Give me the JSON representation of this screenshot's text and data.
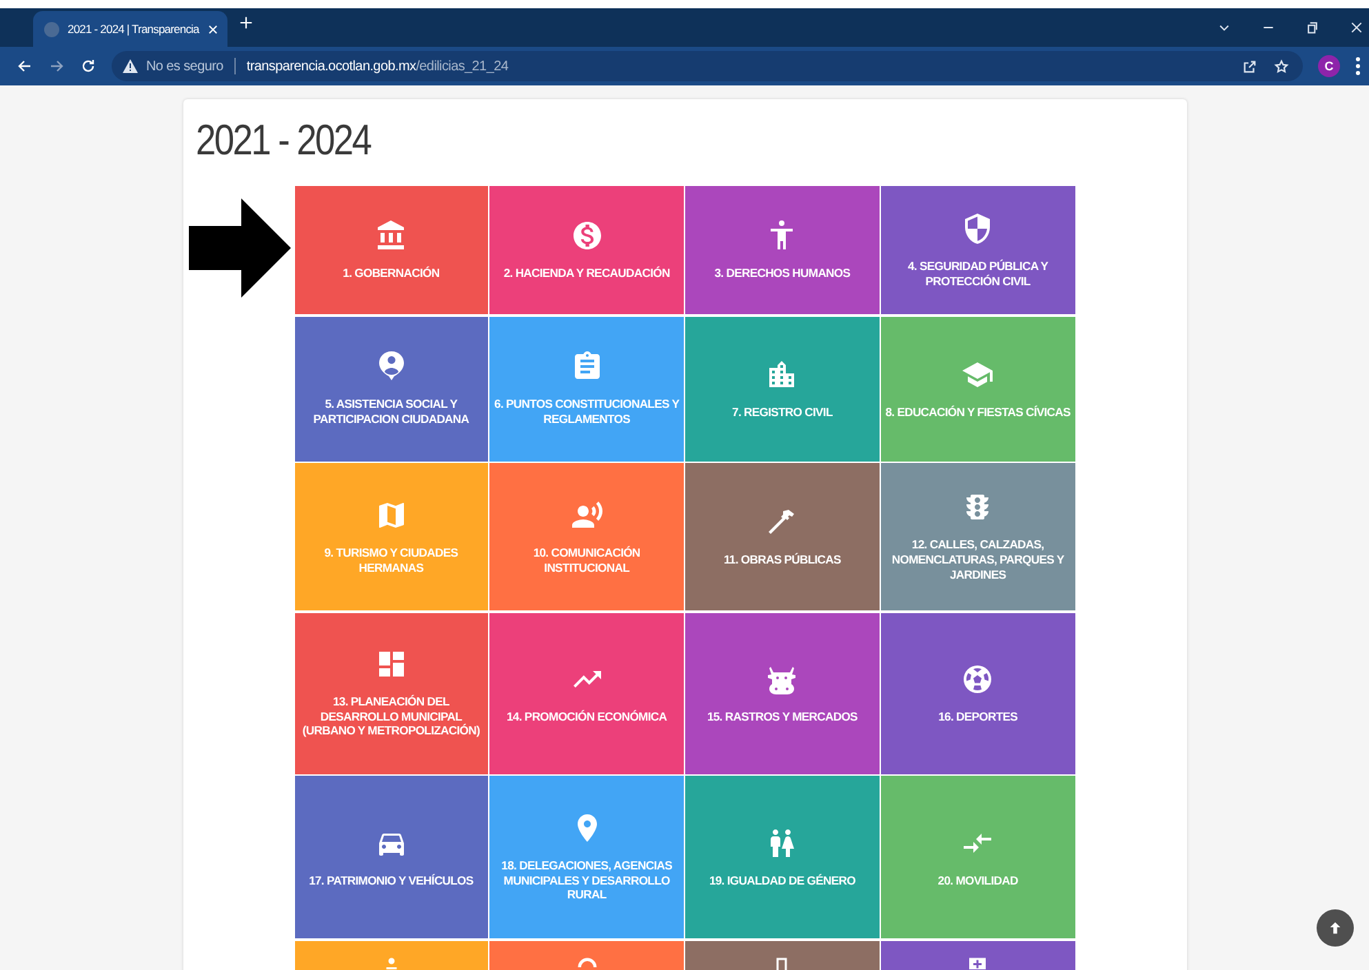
{
  "browser": {
    "tab_title": "2021 - 2024 | Transparencia",
    "security_label": "No es seguro",
    "url_host": "transparencia.ocotlan.gob.mx",
    "url_path": "/edilicias_21_24",
    "profile_initial": "C"
  },
  "page": {
    "title": "2021 - 2024",
    "tiles": [
      {
        "label": "1. GOBERNACIÓN",
        "color": "#ef5350"
      },
      {
        "label": "2. HACIENDA Y RECAUDACIÓN",
        "color": "#ec407a"
      },
      {
        "label": "3. DERECHOS HUMANOS",
        "color": "#ab47bc"
      },
      {
        "label": "4. SEGURIDAD PÚBLICA Y PROTECCIÓN CIVIL",
        "color": "#7e57c2"
      },
      {
        "label": "5. ASISTENCIA SOCIAL Y PARTICIPACION CIUDADANA",
        "color": "#5c6bc0"
      },
      {
        "label": "6. PUNTOS CONSTITUCIONALES Y REGLAMENTOS",
        "color": "#42a5f5"
      },
      {
        "label": "7. REGISTRO CIVIL",
        "color": "#26a69a"
      },
      {
        "label": "8. EDUCACIÓN Y FIESTAS CÍVICAS",
        "color": "#66bb6a"
      },
      {
        "label": "9. TURISMO Y CIUDADES HERMANAS",
        "color": "#ffa726"
      },
      {
        "label": "10. COMUNICACIÓN INSTITUCIONAL",
        "color": "#ff7043"
      },
      {
        "label": "11. OBRAS PÚBLICAS",
        "color": "#8d6e63"
      },
      {
        "label": "12. CALLES, CALZADAS, NOMENCLATURAS, PARQUES Y JARDINES",
        "color": "#78909c"
      },
      {
        "label": "13. PLANEACIÓN DEL DESARROLLO MUNICIPAL (URBANO Y METROPOLIZACIÓN)",
        "color": "#ef5350"
      },
      {
        "label": "14. PROMOCIÓN ECONÓMICA",
        "color": "#ec407a"
      },
      {
        "label": "15. RASTROS Y MERCADOS",
        "color": "#ab47bc"
      },
      {
        "label": "16. DEPORTES",
        "color": "#7e57c2"
      },
      {
        "label": "17. PATRIMONIO Y VEHÍCULOS",
        "color": "#5c6bc0"
      },
      {
        "label": "18. DELEGACIONES, AGENCIAS MUNICIPALES Y DESARROLLO RURAL",
        "color": "#42a5f5"
      },
      {
        "label": "19. IGUALDAD DE GÉNERO",
        "color": "#26a69a"
      },
      {
        "label": "20. MOVILIDAD",
        "color": "#66bb6a"
      },
      {
        "color": "#ffa726"
      },
      {
        "color": "#ff7043"
      },
      {
        "color": "#8d6e63"
      },
      {
        "color": "#7e57c2"
      }
    ]
  }
}
